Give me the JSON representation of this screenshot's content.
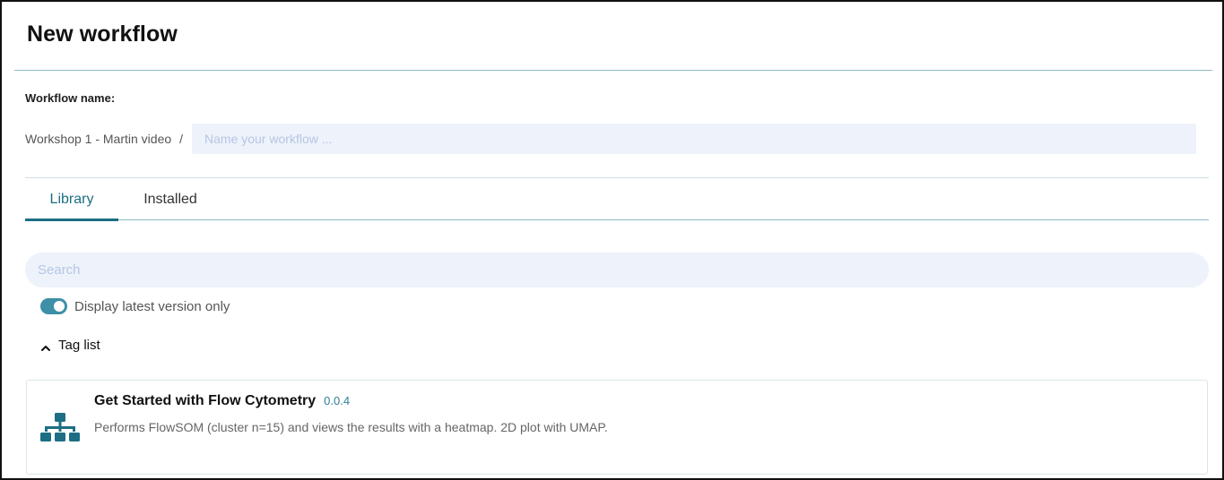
{
  "dialog": {
    "title": "New workflow"
  },
  "workflow_name": {
    "label": "Workflow name:",
    "project_prefix": "Workshop 1 - Martin video",
    "separator": "/",
    "placeholder": "Name your workflow ...",
    "value": ""
  },
  "tabs": [
    {
      "label": "Library",
      "active": true
    },
    {
      "label": "Installed",
      "active": false
    }
  ],
  "search": {
    "placeholder": "Search",
    "value": ""
  },
  "latest_version_toggle": {
    "label": "Display latest version only",
    "on": true
  },
  "tag_list": {
    "label": "Tag list",
    "expanded": true,
    "icon": "chevron-up-icon"
  },
  "templates": [
    {
      "title": "Get Started with Flow Cytometry",
      "version": "0.0.4",
      "description": "Performs FlowSOM (cluster n=15) and views the results with a heatmap. 2D plot with UMAP.",
      "icon": "workflow-hierarchy-icon"
    }
  ],
  "colors": {
    "accent": "#1d6e84",
    "toggle_on": "#3e8fa8",
    "input_bg": "#edf2fb",
    "divider": "#8fbcc7"
  }
}
